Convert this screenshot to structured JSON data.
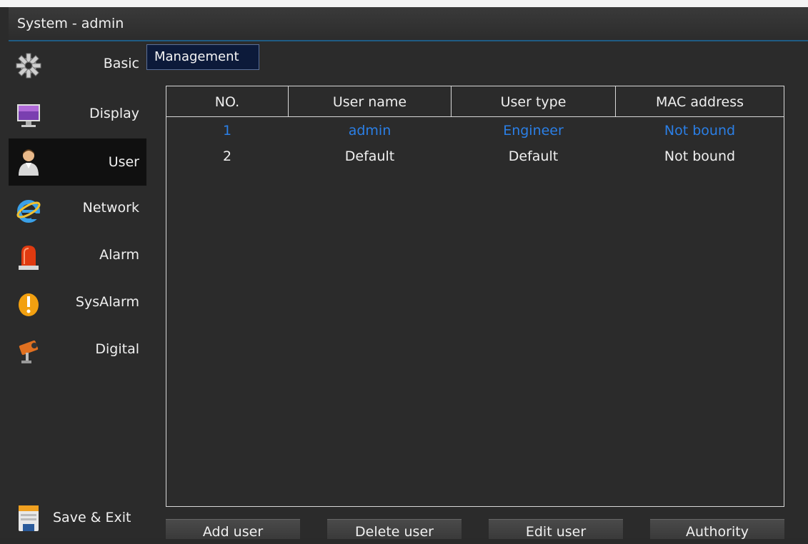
{
  "window": {
    "title": "System - admin"
  },
  "sidebar": {
    "items": [
      {
        "label": "Basic",
        "icon": "gear-icon"
      },
      {
        "label": "Display",
        "icon": "monitor-icon"
      },
      {
        "label": "User",
        "icon": "user-icon",
        "active": true
      },
      {
        "label": "Network",
        "icon": "internet-explorer-icon"
      },
      {
        "label": "Alarm",
        "icon": "siren-icon"
      },
      {
        "label": "SysAlarm",
        "icon": "warning-icon"
      },
      {
        "label": "Digital",
        "icon": "camera-icon"
      }
    ],
    "save_exit": {
      "label": "Save & Exit",
      "icon": "save-icon"
    }
  },
  "tab": {
    "label": "Management"
  },
  "table": {
    "columns": [
      "NO.",
      "User name",
      "User type",
      "MAC address"
    ],
    "rows": [
      [
        "1",
        "admin",
        "Engineer",
        "Not bound"
      ],
      [
        "2",
        "Default",
        "Default",
        "Not bound"
      ]
    ],
    "selected_row": 0
  },
  "buttons": {
    "add": "Add user",
    "delete": "Delete user",
    "edit": "Edit user",
    "authority": "Authority"
  },
  "colors": {
    "selected_text": "#2b7fe6",
    "tab_background": "#0c1a3a",
    "title_underline": "#1f5c84"
  }
}
